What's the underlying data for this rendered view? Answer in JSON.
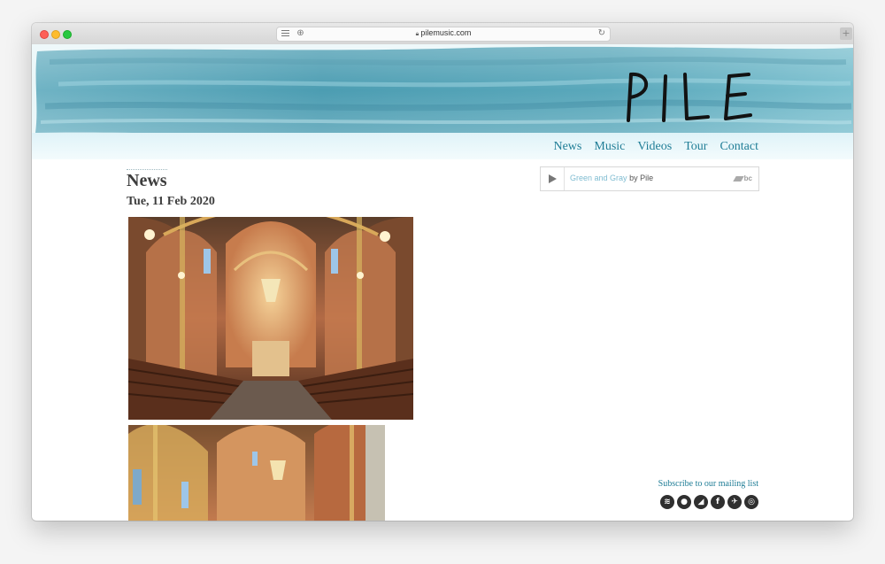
{
  "browser": {
    "url": "pilemusic.com"
  },
  "site": {
    "logo_text": "PILE",
    "nav": [
      {
        "label": "News"
      },
      {
        "label": "Music"
      },
      {
        "label": "Videos"
      },
      {
        "label": "Tour"
      },
      {
        "label": "Contact"
      }
    ]
  },
  "main": {
    "section_title": "News",
    "post_date": "Tue, 11 Feb 2020"
  },
  "player": {
    "track_title": "Green and Gray",
    "by_text": "by Pile",
    "brand": "bc"
  },
  "footer": {
    "subscribe_label": "Subscribe to our mailing list",
    "social_icons": [
      "spotify-icon",
      "apple-icon",
      "bandcamp-icon",
      "facebook-icon",
      "twitter-icon",
      "instagram-icon"
    ]
  },
  "colors": {
    "accent": "#1f7d96",
    "banner_teal": "#4da3b8"
  }
}
